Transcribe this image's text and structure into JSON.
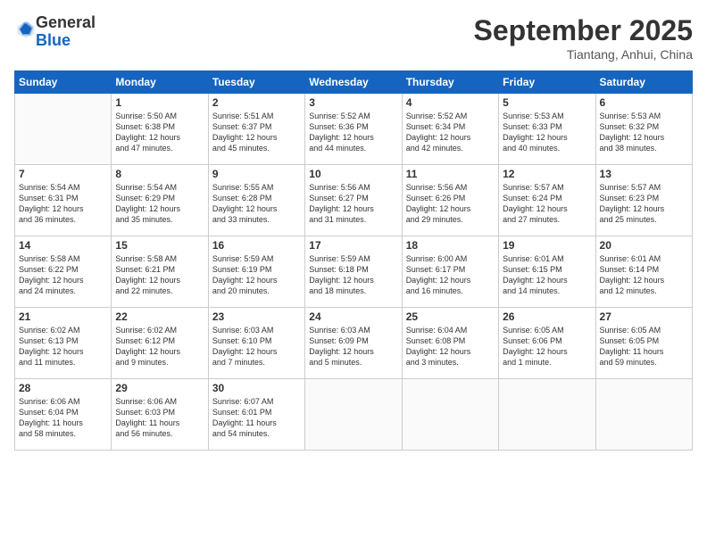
{
  "logo": {
    "general": "General",
    "blue": "Blue"
  },
  "header": {
    "month": "September 2025",
    "location": "Tiantang, Anhui, China"
  },
  "weekdays": [
    "Sunday",
    "Monday",
    "Tuesday",
    "Wednesday",
    "Thursday",
    "Friday",
    "Saturday"
  ],
  "weeks": [
    [
      {
        "day": "",
        "info": ""
      },
      {
        "day": "1",
        "info": "Sunrise: 5:50 AM\nSunset: 6:38 PM\nDaylight: 12 hours\nand 47 minutes."
      },
      {
        "day": "2",
        "info": "Sunrise: 5:51 AM\nSunset: 6:37 PM\nDaylight: 12 hours\nand 45 minutes."
      },
      {
        "day": "3",
        "info": "Sunrise: 5:52 AM\nSunset: 6:36 PM\nDaylight: 12 hours\nand 44 minutes."
      },
      {
        "day": "4",
        "info": "Sunrise: 5:52 AM\nSunset: 6:34 PM\nDaylight: 12 hours\nand 42 minutes."
      },
      {
        "day": "5",
        "info": "Sunrise: 5:53 AM\nSunset: 6:33 PM\nDaylight: 12 hours\nand 40 minutes."
      },
      {
        "day": "6",
        "info": "Sunrise: 5:53 AM\nSunset: 6:32 PM\nDaylight: 12 hours\nand 38 minutes."
      }
    ],
    [
      {
        "day": "7",
        "info": "Sunrise: 5:54 AM\nSunset: 6:31 PM\nDaylight: 12 hours\nand 36 minutes."
      },
      {
        "day": "8",
        "info": "Sunrise: 5:54 AM\nSunset: 6:29 PM\nDaylight: 12 hours\nand 35 minutes."
      },
      {
        "day": "9",
        "info": "Sunrise: 5:55 AM\nSunset: 6:28 PM\nDaylight: 12 hours\nand 33 minutes."
      },
      {
        "day": "10",
        "info": "Sunrise: 5:56 AM\nSunset: 6:27 PM\nDaylight: 12 hours\nand 31 minutes."
      },
      {
        "day": "11",
        "info": "Sunrise: 5:56 AM\nSunset: 6:26 PM\nDaylight: 12 hours\nand 29 minutes."
      },
      {
        "day": "12",
        "info": "Sunrise: 5:57 AM\nSunset: 6:24 PM\nDaylight: 12 hours\nand 27 minutes."
      },
      {
        "day": "13",
        "info": "Sunrise: 5:57 AM\nSunset: 6:23 PM\nDaylight: 12 hours\nand 25 minutes."
      }
    ],
    [
      {
        "day": "14",
        "info": "Sunrise: 5:58 AM\nSunset: 6:22 PM\nDaylight: 12 hours\nand 24 minutes."
      },
      {
        "day": "15",
        "info": "Sunrise: 5:58 AM\nSunset: 6:21 PM\nDaylight: 12 hours\nand 22 minutes."
      },
      {
        "day": "16",
        "info": "Sunrise: 5:59 AM\nSunset: 6:19 PM\nDaylight: 12 hours\nand 20 minutes."
      },
      {
        "day": "17",
        "info": "Sunrise: 5:59 AM\nSunset: 6:18 PM\nDaylight: 12 hours\nand 18 minutes."
      },
      {
        "day": "18",
        "info": "Sunrise: 6:00 AM\nSunset: 6:17 PM\nDaylight: 12 hours\nand 16 minutes."
      },
      {
        "day": "19",
        "info": "Sunrise: 6:01 AM\nSunset: 6:15 PM\nDaylight: 12 hours\nand 14 minutes."
      },
      {
        "day": "20",
        "info": "Sunrise: 6:01 AM\nSunset: 6:14 PM\nDaylight: 12 hours\nand 12 minutes."
      }
    ],
    [
      {
        "day": "21",
        "info": "Sunrise: 6:02 AM\nSunset: 6:13 PM\nDaylight: 12 hours\nand 11 minutes."
      },
      {
        "day": "22",
        "info": "Sunrise: 6:02 AM\nSunset: 6:12 PM\nDaylight: 12 hours\nand 9 minutes."
      },
      {
        "day": "23",
        "info": "Sunrise: 6:03 AM\nSunset: 6:10 PM\nDaylight: 12 hours\nand 7 minutes."
      },
      {
        "day": "24",
        "info": "Sunrise: 6:03 AM\nSunset: 6:09 PM\nDaylight: 12 hours\nand 5 minutes."
      },
      {
        "day": "25",
        "info": "Sunrise: 6:04 AM\nSunset: 6:08 PM\nDaylight: 12 hours\nand 3 minutes."
      },
      {
        "day": "26",
        "info": "Sunrise: 6:05 AM\nSunset: 6:06 PM\nDaylight: 12 hours\nand 1 minute."
      },
      {
        "day": "27",
        "info": "Sunrise: 6:05 AM\nSunset: 6:05 PM\nDaylight: 11 hours\nand 59 minutes."
      }
    ],
    [
      {
        "day": "28",
        "info": "Sunrise: 6:06 AM\nSunset: 6:04 PM\nDaylight: 11 hours\nand 58 minutes."
      },
      {
        "day": "29",
        "info": "Sunrise: 6:06 AM\nSunset: 6:03 PM\nDaylight: 11 hours\nand 56 minutes."
      },
      {
        "day": "30",
        "info": "Sunrise: 6:07 AM\nSunset: 6:01 PM\nDaylight: 11 hours\nand 54 minutes."
      },
      {
        "day": "",
        "info": ""
      },
      {
        "day": "",
        "info": ""
      },
      {
        "day": "",
        "info": ""
      },
      {
        "day": "",
        "info": ""
      }
    ]
  ]
}
